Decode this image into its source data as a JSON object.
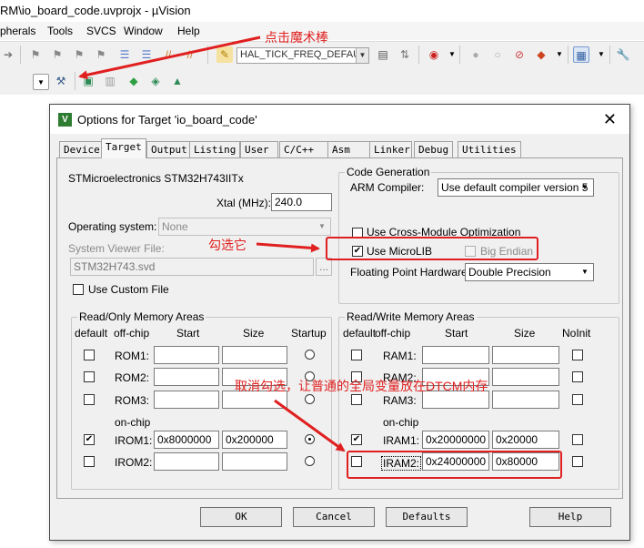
{
  "window": {
    "title": "RM\\io_board_code.uvprojx - µVision"
  },
  "menu": [
    "pherals",
    "Tools",
    "SVCS",
    "Window",
    "Help"
  ],
  "toolbar": {
    "target_combo": "HAL_TICK_FREQ_DEFAULT"
  },
  "dialog": {
    "title": "Options for Target 'io_board_code'",
    "tabs": [
      "Device",
      "Target",
      "Output",
      "Listing",
      "User",
      "C/C++",
      "Asm",
      "Linker",
      "Debug",
      "Utilities"
    ],
    "active_tab": "Target",
    "device_name": "STMicroelectronics STM32H743IITx",
    "xtal_label": "Xtal (MHz):",
    "xtal_value": "240.0",
    "os_label": "Operating system:",
    "os_value": "None",
    "svf_label": "System Viewer File:",
    "svf_value": "STM32H743.svd",
    "svf_browse": "...",
    "use_custom_file": "Use Custom File",
    "codegen": {
      "title": "Code Generation",
      "arm_compiler_label": "ARM Compiler:",
      "arm_compiler_value": "Use default compiler version 5",
      "cross_module": "Use Cross-Module Optimization",
      "use_microlib": "Use MicroLIB",
      "big_endian": "Big Endian",
      "fp_label": "Floating Point Hardware:",
      "fp_value": "Double Precision"
    },
    "rom": {
      "title": "Read/Only Memory Areas",
      "headers": {
        "default": "default",
        "offchip": "off-chip",
        "start": "Start",
        "size": "Size",
        "startup": "Startup"
      },
      "onchip_label": "on-chip",
      "rows": [
        {
          "name": "ROM1:",
          "start": "",
          "size": "",
          "checked": false,
          "startup": false
        },
        {
          "name": "ROM2:",
          "start": "",
          "size": "",
          "checked": false,
          "startup": false
        },
        {
          "name": "ROM3:",
          "start": "",
          "size": "",
          "checked": false,
          "startup": false
        },
        {
          "name": "IROM1:",
          "start": "0x8000000",
          "size": "0x200000",
          "checked": true,
          "startup": true
        },
        {
          "name": "IROM2:",
          "start": "",
          "size": "",
          "checked": false,
          "startup": false
        }
      ]
    },
    "ram": {
      "title": "Read/Write Memory Areas",
      "headers": {
        "default": "default",
        "offchip": "off-chip",
        "start": "Start",
        "size": "Size",
        "noinit": "NoInit"
      },
      "onchip_label": "on-chip",
      "rows": [
        {
          "name": "RAM1:",
          "start": "",
          "size": "",
          "checked": false
        },
        {
          "name": "RAM2:",
          "start": "",
          "size": "",
          "checked": false
        },
        {
          "name": "RAM3:",
          "start": "",
          "size": "",
          "checked": false
        },
        {
          "name": "IRAM1:",
          "start": "0x20000000",
          "size": "0x20000",
          "checked": true
        },
        {
          "name": "IRAM2:",
          "start": "0x24000000",
          "size": "0x80000",
          "checked": false
        }
      ]
    },
    "buttons": {
      "ok": "OK",
      "cancel": "Cancel",
      "defaults": "Defaults",
      "help": "Help"
    }
  },
  "annotations": {
    "magic_wand": "点击魔术棒",
    "check_it": "勾选它",
    "uncheck": "取消勾选，让普通的全局变量放在DTCM内存"
  },
  "colors": {
    "annotation": "#e02020",
    "dialog_bg": "#f0f0f0"
  }
}
